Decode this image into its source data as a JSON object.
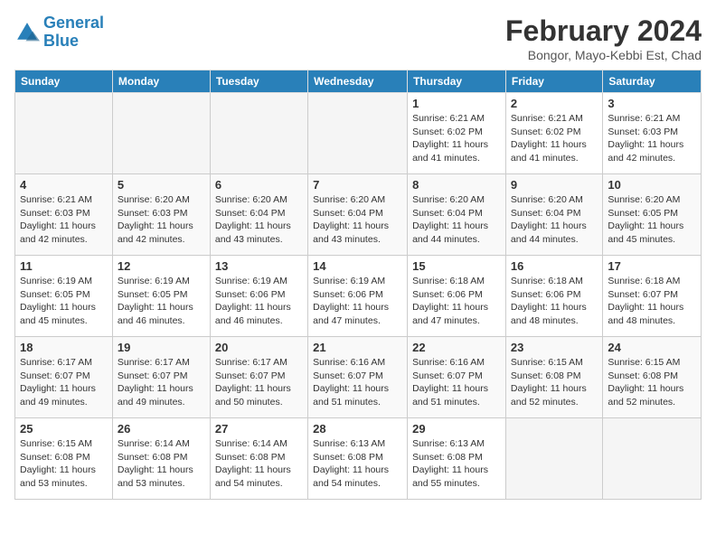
{
  "logo": {
    "line1": "General",
    "line2": "Blue"
  },
  "title": "February 2024",
  "subtitle": "Bongor, Mayo-Kebbi Est, Chad",
  "days_of_week": [
    "Sunday",
    "Monday",
    "Tuesday",
    "Wednesday",
    "Thursday",
    "Friday",
    "Saturday"
  ],
  "weeks": [
    [
      {
        "day": "",
        "info": ""
      },
      {
        "day": "",
        "info": ""
      },
      {
        "day": "",
        "info": ""
      },
      {
        "day": "",
        "info": ""
      },
      {
        "day": "1",
        "info": "Sunrise: 6:21 AM\nSunset: 6:02 PM\nDaylight: 11 hours and 41 minutes."
      },
      {
        "day": "2",
        "info": "Sunrise: 6:21 AM\nSunset: 6:02 PM\nDaylight: 11 hours and 41 minutes."
      },
      {
        "day": "3",
        "info": "Sunrise: 6:21 AM\nSunset: 6:03 PM\nDaylight: 11 hours and 42 minutes."
      }
    ],
    [
      {
        "day": "4",
        "info": "Sunrise: 6:21 AM\nSunset: 6:03 PM\nDaylight: 11 hours and 42 minutes."
      },
      {
        "day": "5",
        "info": "Sunrise: 6:20 AM\nSunset: 6:03 PM\nDaylight: 11 hours and 42 minutes."
      },
      {
        "day": "6",
        "info": "Sunrise: 6:20 AM\nSunset: 6:04 PM\nDaylight: 11 hours and 43 minutes."
      },
      {
        "day": "7",
        "info": "Sunrise: 6:20 AM\nSunset: 6:04 PM\nDaylight: 11 hours and 43 minutes."
      },
      {
        "day": "8",
        "info": "Sunrise: 6:20 AM\nSunset: 6:04 PM\nDaylight: 11 hours and 44 minutes."
      },
      {
        "day": "9",
        "info": "Sunrise: 6:20 AM\nSunset: 6:04 PM\nDaylight: 11 hours and 44 minutes."
      },
      {
        "day": "10",
        "info": "Sunrise: 6:20 AM\nSunset: 6:05 PM\nDaylight: 11 hours and 45 minutes."
      }
    ],
    [
      {
        "day": "11",
        "info": "Sunrise: 6:19 AM\nSunset: 6:05 PM\nDaylight: 11 hours and 45 minutes."
      },
      {
        "day": "12",
        "info": "Sunrise: 6:19 AM\nSunset: 6:05 PM\nDaylight: 11 hours and 46 minutes."
      },
      {
        "day": "13",
        "info": "Sunrise: 6:19 AM\nSunset: 6:06 PM\nDaylight: 11 hours and 46 minutes."
      },
      {
        "day": "14",
        "info": "Sunrise: 6:19 AM\nSunset: 6:06 PM\nDaylight: 11 hours and 47 minutes."
      },
      {
        "day": "15",
        "info": "Sunrise: 6:18 AM\nSunset: 6:06 PM\nDaylight: 11 hours and 47 minutes."
      },
      {
        "day": "16",
        "info": "Sunrise: 6:18 AM\nSunset: 6:06 PM\nDaylight: 11 hours and 48 minutes."
      },
      {
        "day": "17",
        "info": "Sunrise: 6:18 AM\nSunset: 6:07 PM\nDaylight: 11 hours and 48 minutes."
      }
    ],
    [
      {
        "day": "18",
        "info": "Sunrise: 6:17 AM\nSunset: 6:07 PM\nDaylight: 11 hours and 49 minutes."
      },
      {
        "day": "19",
        "info": "Sunrise: 6:17 AM\nSunset: 6:07 PM\nDaylight: 11 hours and 49 minutes."
      },
      {
        "day": "20",
        "info": "Sunrise: 6:17 AM\nSunset: 6:07 PM\nDaylight: 11 hours and 50 minutes."
      },
      {
        "day": "21",
        "info": "Sunrise: 6:16 AM\nSunset: 6:07 PM\nDaylight: 11 hours and 51 minutes."
      },
      {
        "day": "22",
        "info": "Sunrise: 6:16 AM\nSunset: 6:07 PM\nDaylight: 11 hours and 51 minutes."
      },
      {
        "day": "23",
        "info": "Sunrise: 6:15 AM\nSunset: 6:08 PM\nDaylight: 11 hours and 52 minutes."
      },
      {
        "day": "24",
        "info": "Sunrise: 6:15 AM\nSunset: 6:08 PM\nDaylight: 11 hours and 52 minutes."
      }
    ],
    [
      {
        "day": "25",
        "info": "Sunrise: 6:15 AM\nSunset: 6:08 PM\nDaylight: 11 hours and 53 minutes."
      },
      {
        "day": "26",
        "info": "Sunrise: 6:14 AM\nSunset: 6:08 PM\nDaylight: 11 hours and 53 minutes."
      },
      {
        "day": "27",
        "info": "Sunrise: 6:14 AM\nSunset: 6:08 PM\nDaylight: 11 hours and 54 minutes."
      },
      {
        "day": "28",
        "info": "Sunrise: 6:13 AM\nSunset: 6:08 PM\nDaylight: 11 hours and 54 minutes."
      },
      {
        "day": "29",
        "info": "Sunrise: 6:13 AM\nSunset: 6:08 PM\nDaylight: 11 hours and 55 minutes."
      },
      {
        "day": "",
        "info": ""
      },
      {
        "day": "",
        "info": ""
      }
    ]
  ]
}
